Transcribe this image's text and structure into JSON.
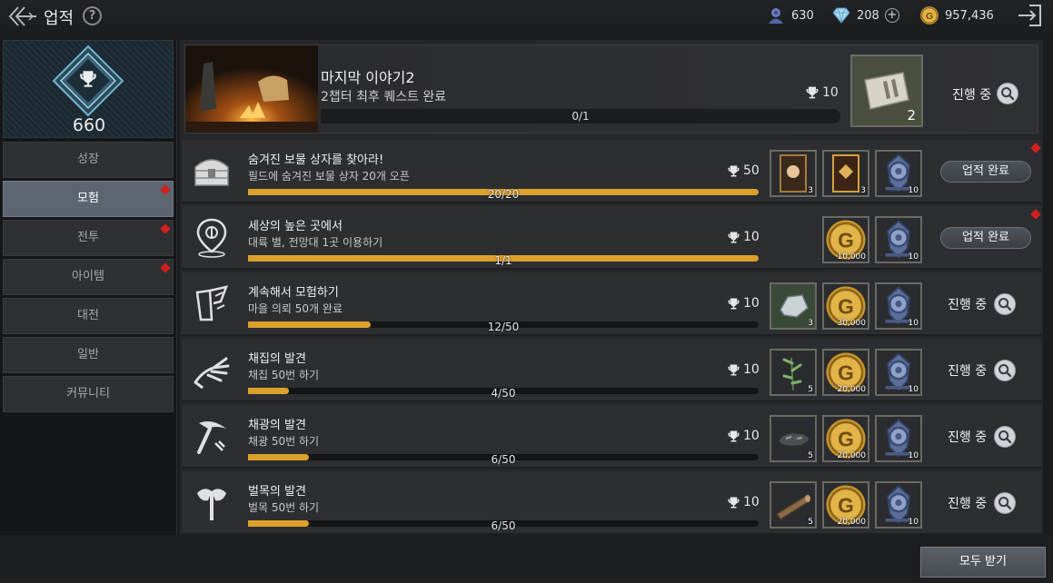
{
  "header": {
    "title": "업적",
    "help_symbol": "?",
    "currencies": [
      {
        "icon": "player-token-icon",
        "value": "630"
      },
      {
        "icon": "diamond-icon",
        "value": "208"
      },
      {
        "icon": "gold-coin-icon",
        "value": "957,436"
      }
    ],
    "add_symbol": "+"
  },
  "sidebar": {
    "achievement_score": "660",
    "categories": [
      {
        "label": "성장",
        "active": false,
        "alert": false
      },
      {
        "label": "모험",
        "active": true,
        "alert": true
      },
      {
        "label": "전투",
        "active": false,
        "alert": true
      },
      {
        "label": "아이템",
        "active": false,
        "alert": true
      },
      {
        "label": "대전",
        "active": false,
        "alert": false
      },
      {
        "label": "일반",
        "active": false,
        "alert": false
      },
      {
        "label": "커뮤니티",
        "active": false,
        "alert": false
      }
    ]
  },
  "featured": {
    "title": "마지막 이야기2",
    "description": "2챕터 최후 퀘스트 완료",
    "trophy_points": "10",
    "progress_text": "0/1",
    "progress": 0,
    "reward_count": "2",
    "status": "진행 중"
  },
  "achievements": [
    {
      "title": "숨겨진 보물 상자를 찾아라!",
      "description": "필드에 숨겨진 보물 상자 20개 오픈",
      "trophy_points": "50",
      "progress_text": "20/20",
      "progress": 1.0,
      "rewards": [
        {
          "icon": "card-pack-bronze-icon",
          "count": "3"
        },
        {
          "icon": "card-pack-gold-icon",
          "count": "3"
        },
        {
          "icon": "achievement-token-icon",
          "count": "10"
        }
      ],
      "action": "업적 완료",
      "completed": true,
      "alert": true,
      "row_icon": "treasure-chest-icon"
    },
    {
      "title": "세상의 높은 곳에서",
      "description": "대륙 별, 전망대 1곳 이용하기",
      "trophy_points": "10",
      "progress_text": "1/1",
      "progress": 1.0,
      "rewards": [
        {
          "icon": "gold-coin-icon",
          "count": "10,000"
        },
        {
          "icon": "achievement-token-icon",
          "count": "10"
        }
      ],
      "action": "업적 완료",
      "completed": true,
      "alert": true,
      "row_icon": "map-pin-icon"
    },
    {
      "title": "계속해서 모험하기",
      "description": "마을 의뢰 50개 완료",
      "trophy_points": "10",
      "progress_text": "12/50",
      "progress": 0.24,
      "rewards": [
        {
          "icon": "ore-crystal-icon",
          "count": "3"
        },
        {
          "icon": "gold-coin-icon",
          "count": "30,000"
        },
        {
          "icon": "achievement-token-icon",
          "count": "10"
        }
      ],
      "action": "진행 중",
      "completed": false,
      "alert": false,
      "row_icon": "quest-scroll-icon"
    },
    {
      "title": "채집의 발견",
      "description": "채집 50번 하기",
      "trophy_points": "10",
      "progress_text": "4/50",
      "progress": 0.08,
      "rewards": [
        {
          "icon": "herb-icon",
          "count": "5"
        },
        {
          "icon": "gold-coin-icon",
          "count": "20,000"
        },
        {
          "icon": "achievement-token-icon",
          "count": "10"
        }
      ],
      "action": "진행 중",
      "completed": false,
      "alert": false,
      "row_icon": "gathering-hand-icon"
    },
    {
      "title": "채광의 발견",
      "description": "채광 50번 하기",
      "trophy_points": "10",
      "progress_text": "6/50",
      "progress": 0.12,
      "rewards": [
        {
          "icon": "ore-icon",
          "count": "5"
        },
        {
          "icon": "gold-coin-icon",
          "count": "20,000"
        },
        {
          "icon": "achievement-token-icon",
          "count": "10"
        }
      ],
      "action": "진행 중",
      "completed": false,
      "alert": false,
      "row_icon": "pickaxe-icon"
    },
    {
      "title": "벌목의 발견",
      "description": "벌목 50번 하기",
      "trophy_points": "10",
      "progress_text": "6/50",
      "progress": 0.12,
      "rewards": [
        {
          "icon": "wood-log-icon",
          "count": "5"
        },
        {
          "icon": "gold-coin-icon",
          "count": "20,000"
        },
        {
          "icon": "achievement-token-icon",
          "count": "10"
        }
      ],
      "action": "진행 중",
      "completed": false,
      "alert": false,
      "row_icon": "axe-icon"
    }
  ],
  "footer": {
    "claim_all_label": "모두 받기"
  },
  "colors": {
    "accent": "#dca12b",
    "alert": "#d51f1f",
    "active_tab": "#5b6670"
  }
}
